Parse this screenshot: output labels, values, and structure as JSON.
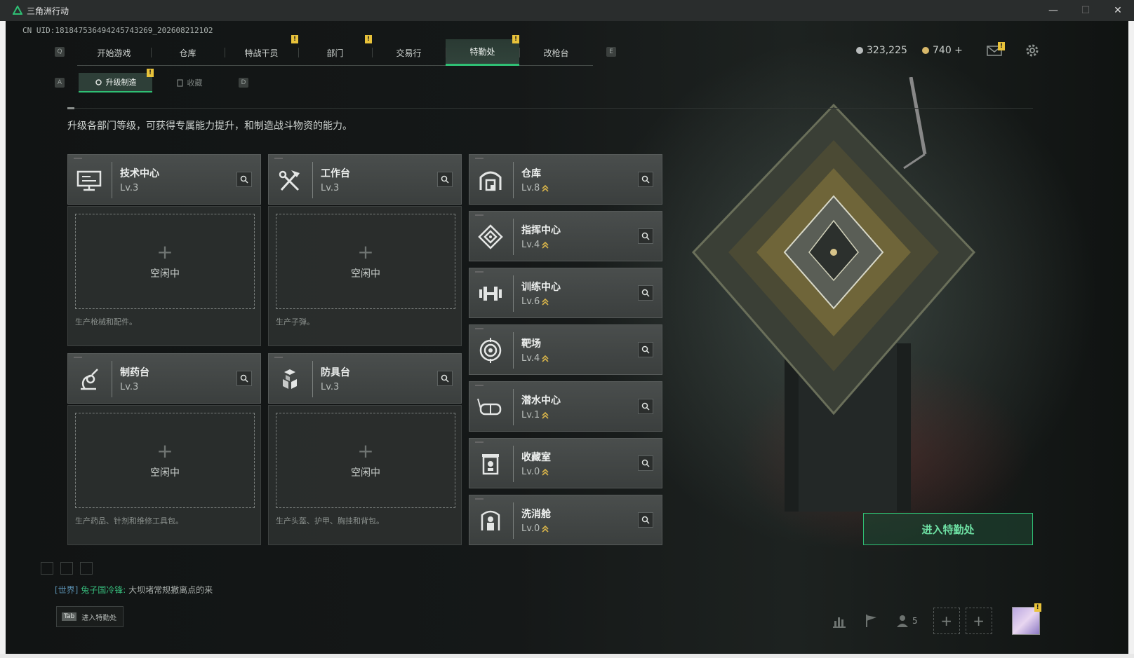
{
  "window": {
    "title": "三角洲行动",
    "controls": {
      "minimize": "—",
      "maximize": "☐",
      "close": "✕"
    }
  },
  "uid_text": "CN UID:18184753649424574326​9_202608212102",
  "top_keys": {
    "left": "Q",
    "right": "E"
  },
  "tabs": [
    {
      "label": "开始游戏",
      "badge": ""
    },
    {
      "label": "仓库",
      "badge": ""
    },
    {
      "label": "特战干员",
      "badge": "!"
    },
    {
      "label": "部门",
      "badge": "!"
    },
    {
      "label": "交易行",
      "badge": ""
    },
    {
      "label": "特勤处",
      "badge": "!",
      "active": true
    },
    {
      "label": "改枪台",
      "badge": ""
    }
  ],
  "currency": {
    "silver": "323,225",
    "gold": "740 +"
  },
  "mail_badge": "!",
  "sub_keys": {
    "left": "A",
    "right": "D"
  },
  "subtabs": [
    {
      "label": "升级制造",
      "badge": "!",
      "active": true
    },
    {
      "label": "收藏",
      "badge": ""
    }
  ],
  "description": "升级各部门等级，可获得专属能力提升，和制造战斗物资的能力。",
  "production_cards": [
    {
      "name": "技术中心",
      "level": "Lv.3",
      "icon": "computer-icon",
      "slot_label": "空闲中",
      "hint": "生产枪械和配件。"
    },
    {
      "name": "工作台",
      "level": "Lv.3",
      "icon": "tools-icon",
      "slot_label": "空闲中",
      "hint": "生产子弹。"
    },
    {
      "name": "制药台",
      "level": "Lv.3",
      "icon": "pharmacy-icon",
      "slot_label": "空闲中",
      "hint": "生产药品、针剂和维修工具包。"
    },
    {
      "name": "防具台",
      "level": "Lv.3",
      "icon": "armor-icon",
      "slot_label": "空闲中",
      "hint": "生产头盔、护甲、胸挂和背包。"
    }
  ],
  "facility_cards": [
    {
      "name": "仓库",
      "level": "Lv.8",
      "icon": "warehouse-icon"
    },
    {
      "name": "指挥中心",
      "level": "Lv.4",
      "icon": "command-icon"
    },
    {
      "name": "训练中心",
      "level": "Lv.6",
      "icon": "dumbbell-icon"
    },
    {
      "name": "靶场",
      "level": "Lv.4",
      "icon": "target-icon"
    },
    {
      "name": "潜水中心",
      "level": "Lv.1",
      "icon": "diving-mask-icon"
    },
    {
      "name": "收藏室",
      "level": "Lv.0",
      "icon": "collection-icon"
    },
    {
      "name": "洗消舱",
      "level": "Lv.0",
      "icon": "decon-icon"
    }
  ],
  "enter_button": "进入特勤处",
  "chat": {
    "channel": "[世界]",
    "user": "兔子国冷锋:",
    "message": "大坝堵常规撤离点的来"
  },
  "tab_hint": {
    "key": "Tab",
    "label": "进入特勤处"
  },
  "friends_count": "5",
  "colors": {
    "accent_green": "#2fbf74",
    "badge_yellow": "#e8c23a",
    "level_up_arrow": "#d8b44a"
  }
}
